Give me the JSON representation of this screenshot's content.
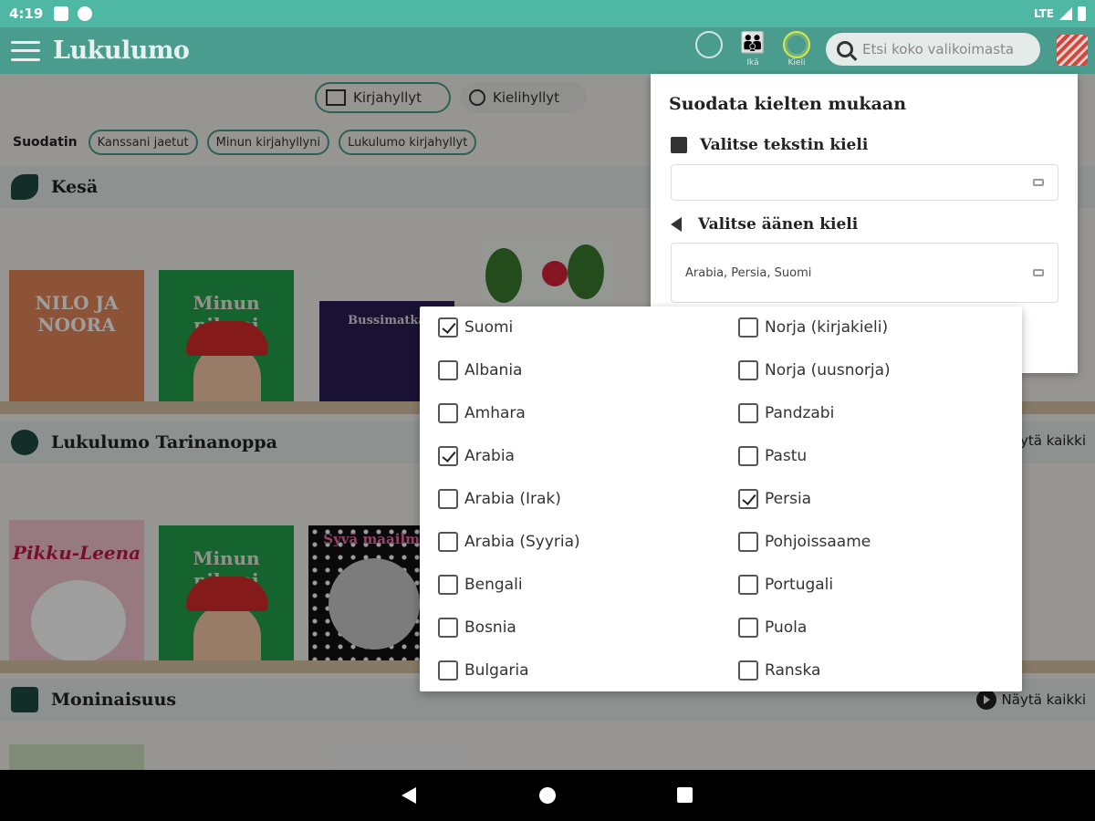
{
  "status_bar": {
    "time": "4:19",
    "network": "LTE"
  },
  "app_bar": {
    "title": "Lukulumo",
    "icons": [
      {
        "name": "reading-icon",
        "label": ""
      },
      {
        "name": "age-icon",
        "label": "Ikä"
      },
      {
        "name": "language-icon",
        "label": "Kieli"
      }
    ],
    "search_placeholder": "Etsi koko valikoimasta"
  },
  "tabs": [
    {
      "label": "Kirjahyllyt",
      "active": true
    },
    {
      "label": "Kielihyllyt",
      "active": false
    }
  ],
  "filters": {
    "label": "Suodatin",
    "chips": [
      "Kanssani jaetut",
      "Minun kirjahyllyni",
      "Lukulumo kirjahyllyt"
    ]
  },
  "sections": [
    {
      "title": "Kesä",
      "show_all": ""
    },
    {
      "title": "Lukulumo Tarinanoppa",
      "show_all": "Näytä kaikki"
    },
    {
      "title": "Moninaisuus",
      "show_all": "Näytä kaikki"
    }
  ],
  "books": {
    "nilo": "NILO JA NOORA",
    "pihani": "Minun pihani",
    "bussi": "Bussimatka",
    "pikku": "Pikku-Leena",
    "syva": "Syvä maailma"
  },
  "filter_panel": {
    "title": "Suodata kielten mukaan",
    "text_language_label": "Valitse tekstin kieli",
    "text_language_value": "",
    "audio_language_label": "Valitse äänen kieli",
    "audio_language_value": "Arabia, Persia, Suomi"
  },
  "language_options": {
    "left": [
      {
        "label": "Suomi",
        "checked": true
      },
      {
        "label": "Albania",
        "checked": false
      },
      {
        "label": "Amhara",
        "checked": false
      },
      {
        "label": "Arabia",
        "checked": true
      },
      {
        "label": "Arabia (Irak)",
        "checked": false
      },
      {
        "label": "Arabia (Syyria)",
        "checked": false
      },
      {
        "label": "Bengali",
        "checked": false
      },
      {
        "label": "Bosnia",
        "checked": false
      },
      {
        "label": "Bulgaria",
        "checked": false
      }
    ],
    "right": [
      {
        "label": "Norja (kirjakieli)",
        "checked": false
      },
      {
        "label": "Norja (uusnorja)",
        "checked": false
      },
      {
        "label": "Pandzabi",
        "checked": false
      },
      {
        "label": "Pastu",
        "checked": false
      },
      {
        "label": "Persia",
        "checked": true
      },
      {
        "label": "Pohjoissaame",
        "checked": false
      },
      {
        "label": "Portugali",
        "checked": false
      },
      {
        "label": "Puola",
        "checked": false
      },
      {
        "label": "Ranska",
        "checked": false
      }
    ]
  }
}
